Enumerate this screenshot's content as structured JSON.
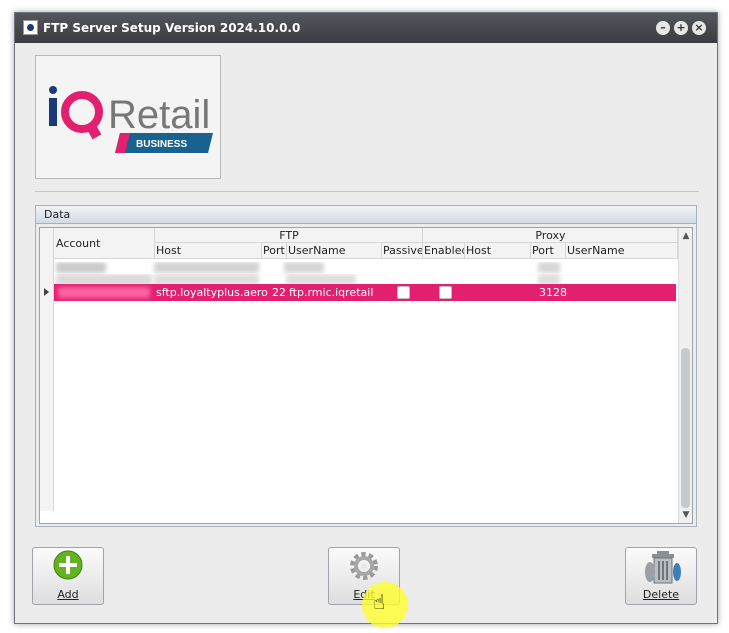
{
  "window": {
    "title": "FTP Server Setup Version 2024.10.0.0"
  },
  "logo": {
    "brand": "iQRetail",
    "tag": "BUSINESS"
  },
  "data_group": {
    "title": "Data"
  },
  "grid": {
    "col_account": "Account",
    "band_ftp": "FTP",
    "band_proxy": "Proxy",
    "col_host": "Host",
    "col_port": "Port",
    "col_username": "UserName",
    "col_passive": "Passive",
    "col_enabled": "Enabled",
    "col_proxy_host": "Host",
    "col_proxy_port": "Port",
    "col_proxy_username": "UserName",
    "selected_row": {
      "host": "sftp.loyaltyplus.aero",
      "port": "22",
      "username": "ftp.rmic.iqretail",
      "proxy_port": "3128"
    }
  },
  "buttons": {
    "add": "Add",
    "edit": "Edit",
    "delete": "Delete"
  },
  "colors": {
    "selection": "#e2206f",
    "title_bar": "#3a3c41"
  }
}
